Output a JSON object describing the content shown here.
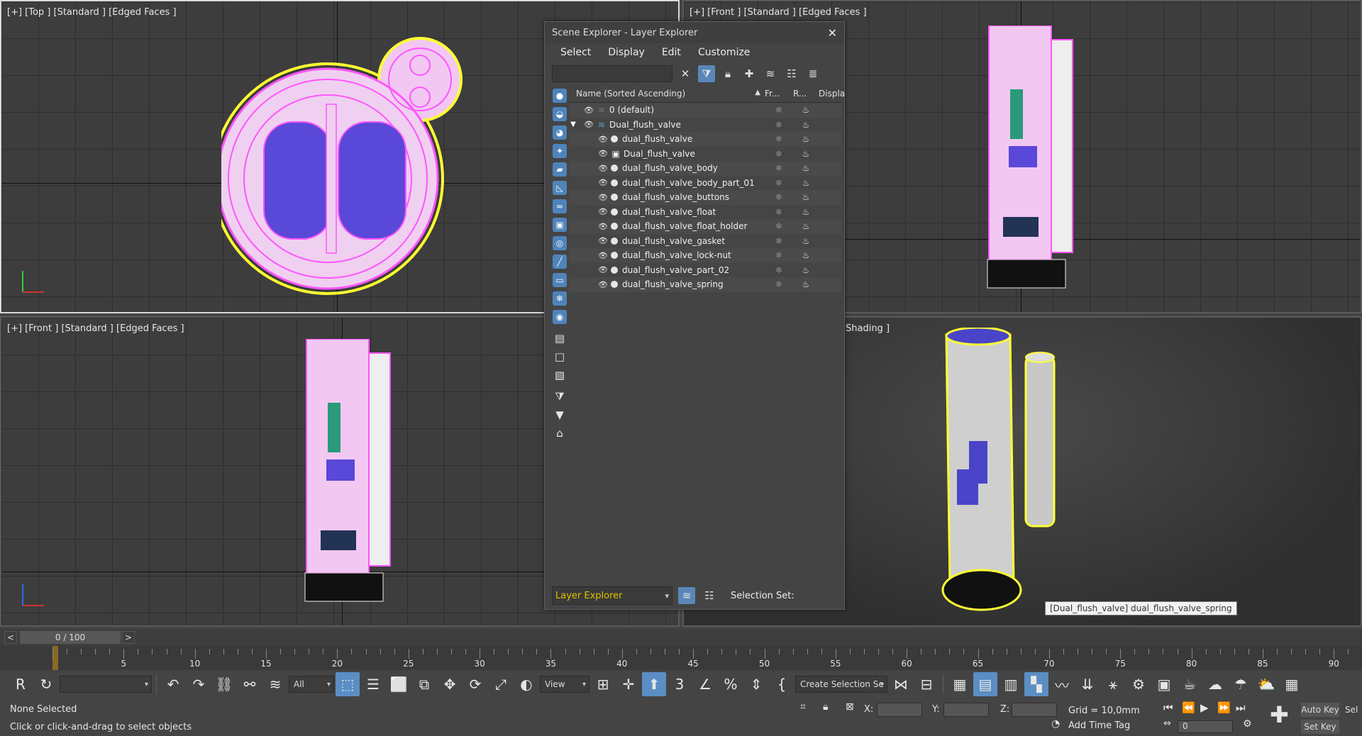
{
  "viewports": {
    "top": {
      "label": "[+] [Top ] [Standard ] [Edged Faces ]"
    },
    "front_right": {
      "label": "[+] [Front ] [Standard ] [Edged Faces ]"
    },
    "front_left": {
      "label": "[+] [Front ] [Standard ] [Edged Faces ]"
    },
    "persp": {
      "label": "Shading ]"
    }
  },
  "scene_explorer": {
    "title": "Scene Explorer - Layer Explorer",
    "menu": [
      "Select",
      "Display",
      "Edit",
      "Customize"
    ],
    "search_placeholder": "",
    "columns": {
      "name": "Name (Sorted Ascending)",
      "sort_indicator": "▲",
      "frozen": "Fr...",
      "render": "R...",
      "display": "Displa"
    },
    "rows": [
      {
        "name": "0 (default)",
        "level": 0,
        "type": "layer"
      },
      {
        "name": "Dual_flush_valve",
        "level": 0,
        "type": "layer-expanded"
      },
      {
        "name": "dual_flush_valve",
        "level": 1,
        "type": "object"
      },
      {
        "name": "Dual_flush_valve",
        "level": 1,
        "type": "group"
      },
      {
        "name": "dual_flush_valve_body",
        "level": 1,
        "type": "object"
      },
      {
        "name": "dual_flush_valve_body_part_01",
        "level": 1,
        "type": "object"
      },
      {
        "name": "dual_flush_valve_buttons",
        "level": 1,
        "type": "object"
      },
      {
        "name": "dual_flush_valve_float",
        "level": 1,
        "type": "object"
      },
      {
        "name": "dual_flush_valve_float_holder",
        "level": 1,
        "type": "object"
      },
      {
        "name": "dual_flush_valve_gasket",
        "level": 1,
        "type": "object"
      },
      {
        "name": "dual_flush_valve_lock-nut",
        "level": 1,
        "type": "object"
      },
      {
        "name": "dual_flush_valve_part_02",
        "level": 1,
        "type": "object"
      },
      {
        "name": "dual_flush_valve_spring",
        "level": 1,
        "type": "object"
      }
    ],
    "explorer_mode": "Layer Explorer",
    "selection_set_label": "Selection Set:"
  },
  "tooltip": "[Dual_flush_valve] dual_flush_valve_spring",
  "timeslider": {
    "frame": "0 / 100",
    "prev": "<",
    "next": ">"
  },
  "track": {
    "labels": [
      "5",
      "10",
      "15",
      "20",
      "25",
      "30",
      "35",
      "40",
      "45",
      "50",
      "55",
      "60",
      "65",
      "70",
      "75",
      "80",
      "85",
      "90"
    ]
  },
  "toolbar": {
    "filter": "All",
    "ref_coord": "View",
    "selection_set_placeholder": "Create Selection Se"
  },
  "status": {
    "selection": "None Selected",
    "prompt": "Click or click-and-drag to select objects",
    "x_label": "X:",
    "y_label": "Y:",
    "z_label": "Z:",
    "grid": "Grid = 10,0mm",
    "add_time_tag": "Add Time Tag",
    "auto_key": "Auto Key",
    "set_key": "Set Key",
    "frame_value": "0",
    "sel_cut": "Sel"
  },
  "colors": {
    "wire_pink": "#ff66ff",
    "face_blue": "#5a48d8",
    "selection_yellow": "#ffff33",
    "accent_blue": "#5b8ec5",
    "layer_yellow": "#e3c000"
  }
}
